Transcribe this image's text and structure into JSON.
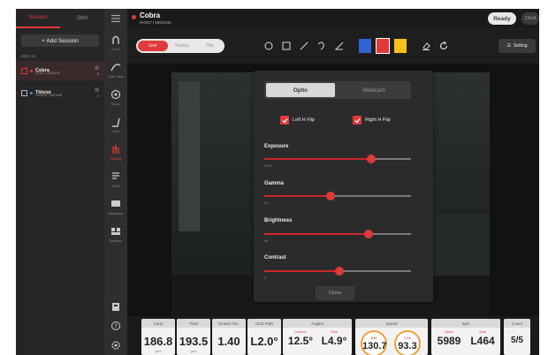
{
  "sessions_panel": {
    "tabs": [
      "Session",
      "Shot"
    ],
    "add_label": "+ Add Session",
    "date": "2023-11",
    "items": [
      {
        "name": "Cobra",
        "sub": "IRON7 | MEDIUM",
        "count": "5",
        "color": "#e03a3a",
        "active": true
      },
      {
        "name": "Titleist",
        "sub": "DRIVER | MEDIUM",
        "count": "0",
        "color": "#4a8be0",
        "active": false
      }
    ]
  },
  "nav": {
    "items": [
      {
        "label": "Front",
        "icon": "front-view-icon"
      },
      {
        "label": "Side View",
        "icon": "side-view-icon"
      },
      {
        "label": "Group",
        "icon": "group-icon"
      },
      {
        "label": "Club",
        "icon": "club-icon"
      },
      {
        "label": "Setting",
        "icon": "setting-icon",
        "active": true
      },
      {
        "label": "Shot",
        "icon": "shot-icon"
      },
      {
        "label": "Sessions",
        "icon": "sessions-icon"
      },
      {
        "label": "Number",
        "icon": "number-icon"
      }
    ],
    "bottom_icons": [
      "export-icon",
      "help-icon",
      "settings-icon"
    ]
  },
  "header": {
    "club": "Cobra",
    "sub": "IRON7 | MEDIUM",
    "status": "Ready",
    "exit": "Exit"
  },
  "toolbar": {
    "modes": [
      "Live",
      "Replay",
      "Title"
    ],
    "active_mode": "Live",
    "tools": [
      "circle-tool-icon",
      "rectangle-tool-icon",
      "line-tool-icon",
      "curve-tool-icon",
      "angle-tool-icon"
    ],
    "colors": [
      "#2f63d6",
      "#e03a3a",
      "#f4c21b"
    ],
    "actions": [
      "eraser-icon",
      "refresh-icon"
    ],
    "setting": "Setting"
  },
  "dialog": {
    "tabs": [
      "Optic",
      "Webcam"
    ],
    "active_tab": "Optic",
    "left_flip": "Left H Flip",
    "right_flip": "Right H Flip",
    "sliders": [
      {
        "label": "Exposure",
        "value_text": "2050",
        "fraction": 0.73
      },
      {
        "label": "Gamma",
        "value_text": "0.4",
        "fraction": 0.45
      },
      {
        "label": "Brightness",
        "value_text": "46",
        "fraction": 0.71
      },
      {
        "label": "Contrast",
        "value_text": "3",
        "fraction": 0.51
      }
    ],
    "close": "Close"
  },
  "metrics": {
    "carry": {
      "header": "Carry",
      "value": "186.8",
      "unit": "yard"
    },
    "total": {
      "header": "Total",
      "value": "193.5",
      "unit": "yard"
    },
    "smash": {
      "header": "Smash Fac.",
      "value": "1.40"
    },
    "club_path": {
      "header": "Club Path",
      "value": "L2.0°"
    },
    "angles": {
      "header": "Angles",
      "launch_label": "Launch",
      "launch": "12.5°",
      "side_label": "Side",
      "side": "L4.9°"
    },
    "speed": {
      "header": "Speed",
      "ball_label": "Ball",
      "ball": "130.7",
      "club_label": "Club",
      "club": "93.3"
    },
    "spin": {
      "header": "Spin",
      "back_label": "Back",
      "back": "5989",
      "side_label": "Side",
      "side": "L464"
    },
    "count": {
      "header": "Count",
      "value": "5/5"
    }
  }
}
